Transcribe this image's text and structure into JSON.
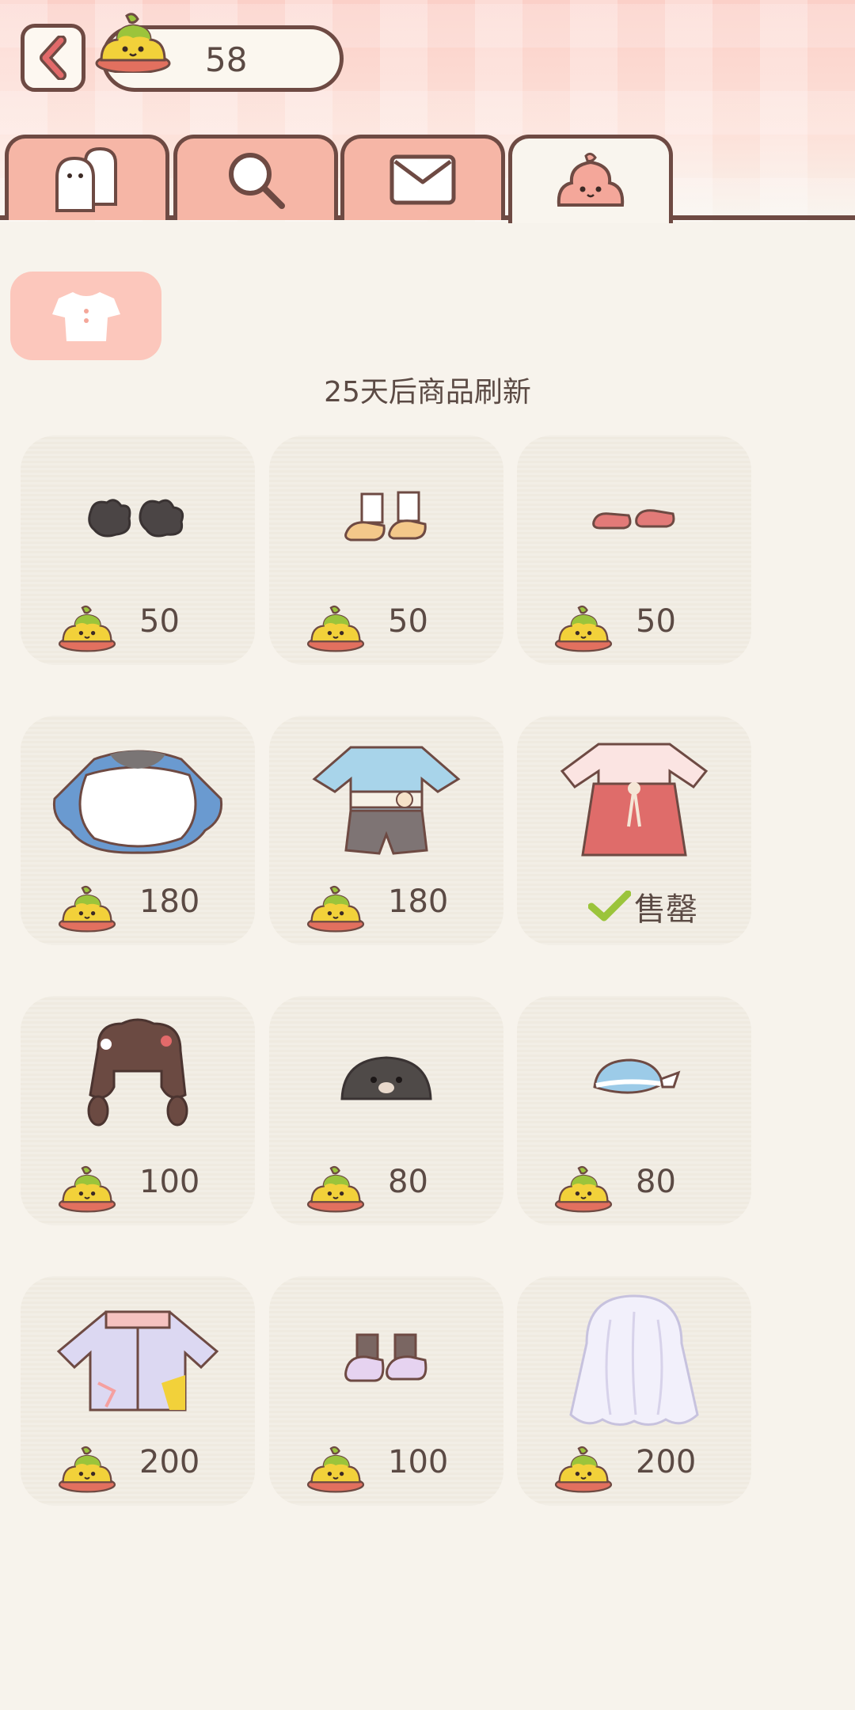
{
  "header": {
    "currency_amount": "58",
    "currency_icon": "poop-coin-icon",
    "back_icon": "chevron-left-icon"
  },
  "tabs": [
    {
      "name": "friends",
      "icon": "ghost-friends-icon",
      "active": false
    },
    {
      "name": "search",
      "icon": "search-icon",
      "active": false
    },
    {
      "name": "mail",
      "icon": "mail-icon",
      "active": false
    },
    {
      "name": "shop",
      "icon": "pink-blob-icon",
      "active": true
    }
  ],
  "category": {
    "icon": "shirt-icon"
  },
  "refresh_text": "25天后商品刷新",
  "items": [
    {
      "name": "dark-fuzzy-gloves",
      "price": "50",
      "sold_out": false
    },
    {
      "name": "white-socks-sandals",
      "price": "50",
      "sold_out": false
    },
    {
      "name": "red-flat-shoes",
      "price": "50",
      "sold_out": false
    },
    {
      "name": "white-blue-cape",
      "price": "180",
      "sold_out": false
    },
    {
      "name": "blue-hanfu-outfit",
      "price": "180",
      "sold_out": false
    },
    {
      "name": "red-hanfu-dress",
      "price": "",
      "sold_out": true,
      "sold_label": "售罄"
    },
    {
      "name": "brown-braided-hair",
      "price": "100",
      "sold_out": false
    },
    {
      "name": "mole-hat",
      "price": "80",
      "sold_out": false
    },
    {
      "name": "blue-bandana",
      "price": "80",
      "sold_out": false
    },
    {
      "name": "pastel-track-jacket",
      "price": "200",
      "sold_out": false
    },
    {
      "name": "pink-sneakers",
      "price": "100",
      "sold_out": false
    },
    {
      "name": "white-long-wig",
      "price": "200",
      "sold_out": false
    }
  ],
  "colors": {
    "accent_pink": "#f6b6a6",
    "outline_brown": "#6e4a43",
    "card_bg": "#efeae0",
    "page_bg": "#f7f3ec",
    "check_green": "#9bc43b"
  }
}
